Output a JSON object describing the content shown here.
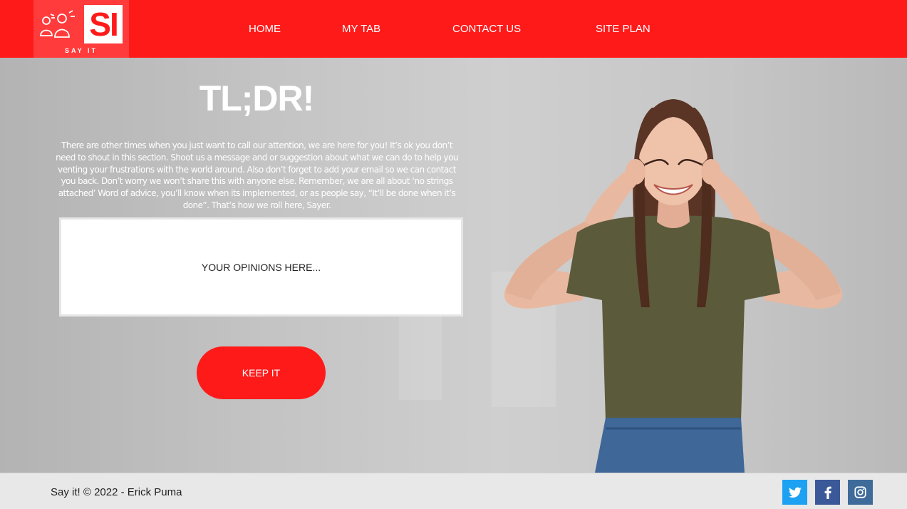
{
  "header": {
    "logo_caption": "SAY IT",
    "logo_letters": "SI",
    "nav": [
      "HOME",
      "MY TAB",
      "CONTACT US",
      "SITE PLAN"
    ]
  },
  "hero": {
    "title": "TL;DR!",
    "body": "There are other times when you just want to call our attention, we are here for you! It’s ok you don’t need to shout in this section. Shoot us a message and or suggestion about what we can do to help you venting your frustrations with the world around. Also don’t forget to add your email so we can contact you back. Don’t worry we won’t share this with anyone else. Remember, we are all about ‘no strings attached’ Word of advice, you’ll know when its implemented, or as people say, “It’ll be done when it’s done”. That’s how we roll here, Sayer.",
    "input_placeholder": "YOUR OPINIONS HERE...",
    "button_label": "KEEP IT"
  },
  "footer": {
    "text": "Say it! © 2022 - Erick Puma",
    "social": [
      {
        "icon": "twitter-icon",
        "color": "#1da1f2"
      },
      {
        "icon": "facebook-icon",
        "color": "#3b5998"
      },
      {
        "icon": "instagram-icon",
        "color": "#3f6b9a"
      }
    ]
  },
  "colors": {
    "brand_red": "#ff1a1a",
    "logo_bg": "#ff3b3b",
    "footer_bg": "#e8e8e8"
  }
}
